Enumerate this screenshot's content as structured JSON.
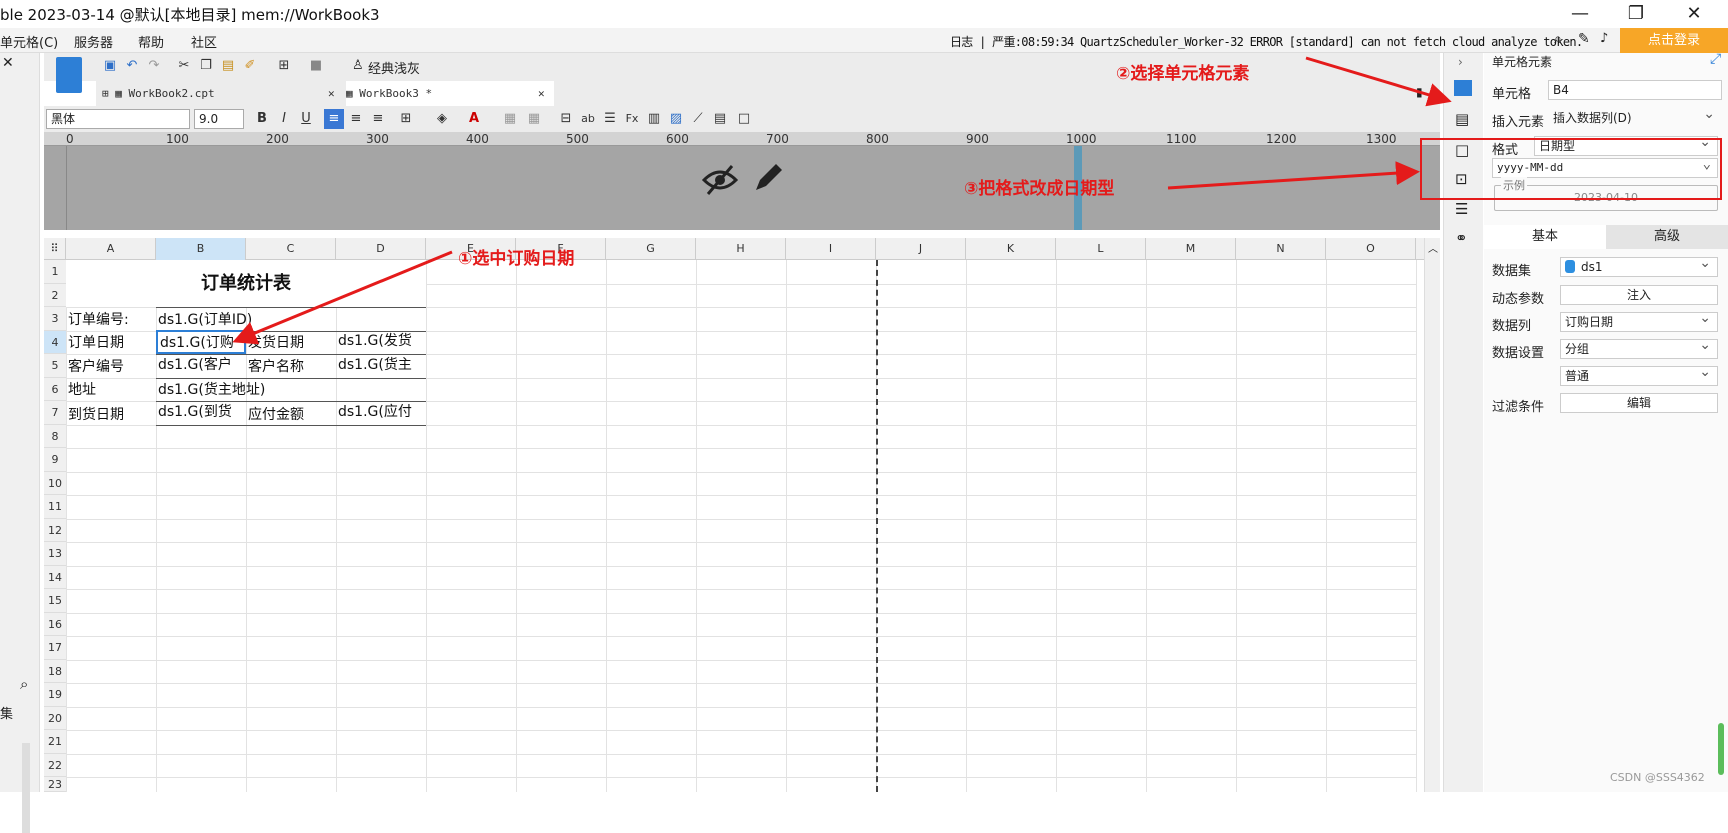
{
  "window": {
    "title": "ble 2023-03-14 @默认[本地目录]    mem://WorkBook3",
    "min": "—",
    "max": "❐",
    "close": "✕"
  },
  "menu": {
    "items": [
      "单元格(C)",
      "服务器",
      "帮助",
      "社区"
    ],
    "log": "日志 | 严重:08:59:34 QuartzScheduler_Worker-32 ERROR [standard] can not fetch cloud analyze token.",
    "login": "点击登录"
  },
  "toolbar": {
    "theme": "经典浅灰",
    "font": "黑体",
    "size": "9.0"
  },
  "tabs": [
    {
      "label": "WorkBook2.cpt",
      "close": "✕"
    },
    {
      "label": "WorkBook3 *",
      "close": "✕"
    }
  ],
  "ruler": [
    "0",
    "100",
    "200",
    "300",
    "400",
    "500",
    "600",
    "700",
    "800",
    "900",
    "1000",
    "1100",
    "1200",
    "1300"
  ],
  "grid": {
    "columns": [
      "A",
      "B",
      "C",
      "D",
      "E",
      "F",
      "G",
      "H",
      "I",
      "J",
      "K",
      "L",
      "M",
      "N",
      "O"
    ],
    "rows": [
      "1",
      "2",
      "3",
      "4",
      "5",
      "6",
      "7",
      "8",
      "9",
      "10",
      "11",
      "12",
      "13",
      "14",
      "15",
      "16",
      "17",
      "18",
      "19",
      "20",
      "21",
      "22",
      "23"
    ],
    "title": "订单统计表",
    "cells": {
      "a3": "订单编号:",
      "b3": "ds1.G(订单ID)",
      "a4": "订单日期",
      "b4": "ds1.G(订购",
      "c4": "发货日期",
      "d4": "ds1.G(发货",
      "a5": "客户编号",
      "b5": "ds1.G(客户",
      "c5": "客户名称",
      "d5": "ds1.G(货主",
      "a6": "地址",
      "b6": "ds1.G(货主地址)",
      "a7": "到货日期",
      "b7": "ds1.G(到货",
      "c7": "应付金额",
      "d7": "ds1.G(应付"
    }
  },
  "annotations": {
    "step1": "①选中订购日期",
    "step2": "②选择单元格元素",
    "step3": "③把格式改成日期型"
  },
  "panel": {
    "title": "单元格元素",
    "cell_label": "单元格",
    "cell_value": "B4",
    "insert_label": "插入元素",
    "insert_value": "插入数据列(D)",
    "format_label": "格式",
    "format_value": "日期型",
    "pattern_value": "yyyy-MM-dd",
    "example_label": "示例",
    "example_value": "2023-04-10",
    "tab_basic": "基本",
    "tab_advanced": "高级",
    "dataset_label": "数据集",
    "dataset_value": "ds1",
    "param_label": "动态参数",
    "param_btn": "注入",
    "column_label": "数据列",
    "column_value": "订购日期",
    "setting_label": "数据设置",
    "setting_value": "分组",
    "setting_value2": "普通",
    "filter_label": "过滤条件",
    "filter_btn": "编辑"
  },
  "watermark": "CSDN @SSS4362",
  "left": {
    "label": "集"
  }
}
